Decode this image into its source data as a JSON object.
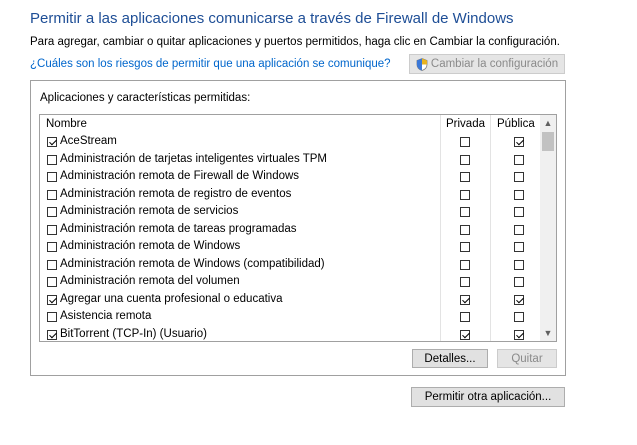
{
  "title": "Permitir a las aplicaciones comunicarse a través de Firewall de Windows",
  "description": "Para agregar, cambiar o quitar aplicaciones y puertos permitidos, haga clic en Cambiar la configuración.",
  "risk_link": "¿Cuáles son los riesgos de permitir que una aplicación se comunique?",
  "change_settings_button": "Cambiar la configuración",
  "group_label": "Aplicaciones y características permitidas:",
  "columns": {
    "name": "Nombre",
    "private": "Privada",
    "public": "Pública"
  },
  "apps": [
    {
      "name": "AceStream",
      "enabled": true,
      "private": false,
      "public": true
    },
    {
      "name": "Administración de tarjetas inteligentes virtuales TPM",
      "enabled": false,
      "private": false,
      "public": false
    },
    {
      "name": "Administración remota de Firewall de Windows",
      "enabled": false,
      "private": false,
      "public": false
    },
    {
      "name": "Administración remota de registro de eventos",
      "enabled": false,
      "private": false,
      "public": false
    },
    {
      "name": "Administración remota de servicios",
      "enabled": false,
      "private": false,
      "public": false
    },
    {
      "name": "Administración remota de tareas programadas",
      "enabled": false,
      "private": false,
      "public": false
    },
    {
      "name": "Administración remota de Windows",
      "enabled": false,
      "private": false,
      "public": false
    },
    {
      "name": "Administración remota de Windows (compatibilidad)",
      "enabled": false,
      "private": false,
      "public": false
    },
    {
      "name": "Administración remota del volumen",
      "enabled": false,
      "private": false,
      "public": false
    },
    {
      "name": "Agregar una cuenta profesional o educativa",
      "enabled": true,
      "private": true,
      "public": true
    },
    {
      "name": "Asistencia remota",
      "enabled": false,
      "private": false,
      "public": false
    },
    {
      "name": "BitTorrent (TCP-In) (Usuario)",
      "enabled": true,
      "private": true,
      "public": true
    }
  ],
  "details_button": "Detalles...",
  "remove_button": "Quitar",
  "allow_other_button": "Permitir otra aplicación...",
  "colors": {
    "title": "#1e4e96",
    "link": "#0066cc",
    "button": "#e1e1e1"
  }
}
